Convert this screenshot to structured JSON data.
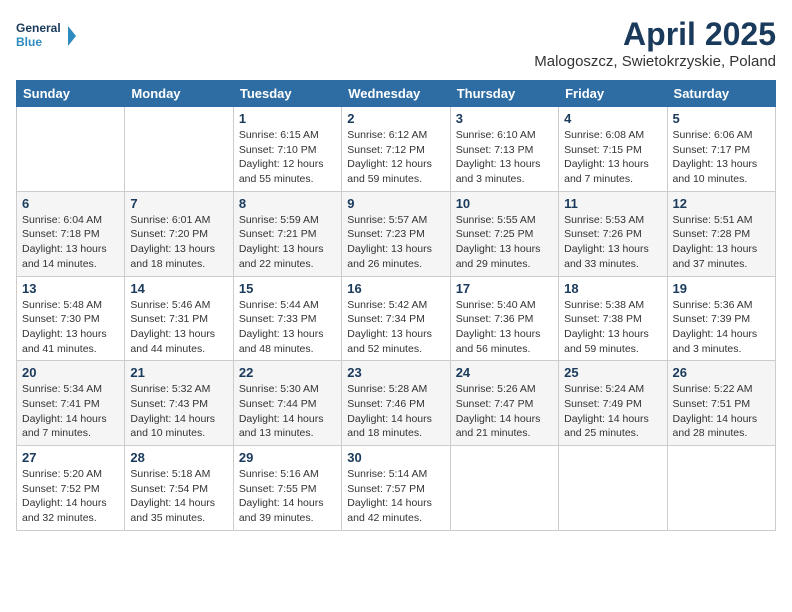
{
  "header": {
    "logo_line1": "General",
    "logo_line2": "Blue",
    "title": "April 2025",
    "subtitle": "Malogoszcz, Swietokrzyskie, Poland"
  },
  "weekdays": [
    "Sunday",
    "Monday",
    "Tuesday",
    "Wednesday",
    "Thursday",
    "Friday",
    "Saturday"
  ],
  "weeks": [
    [
      {
        "day": "",
        "info": ""
      },
      {
        "day": "",
        "info": ""
      },
      {
        "day": "1",
        "info": "Sunrise: 6:15 AM\nSunset: 7:10 PM\nDaylight: 12 hours\nand 55 minutes."
      },
      {
        "day": "2",
        "info": "Sunrise: 6:12 AM\nSunset: 7:12 PM\nDaylight: 12 hours\nand 59 minutes."
      },
      {
        "day": "3",
        "info": "Sunrise: 6:10 AM\nSunset: 7:13 PM\nDaylight: 13 hours\nand 3 minutes."
      },
      {
        "day": "4",
        "info": "Sunrise: 6:08 AM\nSunset: 7:15 PM\nDaylight: 13 hours\nand 7 minutes."
      },
      {
        "day": "5",
        "info": "Sunrise: 6:06 AM\nSunset: 7:17 PM\nDaylight: 13 hours\nand 10 minutes."
      }
    ],
    [
      {
        "day": "6",
        "info": "Sunrise: 6:04 AM\nSunset: 7:18 PM\nDaylight: 13 hours\nand 14 minutes."
      },
      {
        "day": "7",
        "info": "Sunrise: 6:01 AM\nSunset: 7:20 PM\nDaylight: 13 hours\nand 18 minutes."
      },
      {
        "day": "8",
        "info": "Sunrise: 5:59 AM\nSunset: 7:21 PM\nDaylight: 13 hours\nand 22 minutes."
      },
      {
        "day": "9",
        "info": "Sunrise: 5:57 AM\nSunset: 7:23 PM\nDaylight: 13 hours\nand 26 minutes."
      },
      {
        "day": "10",
        "info": "Sunrise: 5:55 AM\nSunset: 7:25 PM\nDaylight: 13 hours\nand 29 minutes."
      },
      {
        "day": "11",
        "info": "Sunrise: 5:53 AM\nSunset: 7:26 PM\nDaylight: 13 hours\nand 33 minutes."
      },
      {
        "day": "12",
        "info": "Sunrise: 5:51 AM\nSunset: 7:28 PM\nDaylight: 13 hours\nand 37 minutes."
      }
    ],
    [
      {
        "day": "13",
        "info": "Sunrise: 5:48 AM\nSunset: 7:30 PM\nDaylight: 13 hours\nand 41 minutes."
      },
      {
        "day": "14",
        "info": "Sunrise: 5:46 AM\nSunset: 7:31 PM\nDaylight: 13 hours\nand 44 minutes."
      },
      {
        "day": "15",
        "info": "Sunrise: 5:44 AM\nSunset: 7:33 PM\nDaylight: 13 hours\nand 48 minutes."
      },
      {
        "day": "16",
        "info": "Sunrise: 5:42 AM\nSunset: 7:34 PM\nDaylight: 13 hours\nand 52 minutes."
      },
      {
        "day": "17",
        "info": "Sunrise: 5:40 AM\nSunset: 7:36 PM\nDaylight: 13 hours\nand 56 minutes."
      },
      {
        "day": "18",
        "info": "Sunrise: 5:38 AM\nSunset: 7:38 PM\nDaylight: 13 hours\nand 59 minutes."
      },
      {
        "day": "19",
        "info": "Sunrise: 5:36 AM\nSunset: 7:39 PM\nDaylight: 14 hours\nand 3 minutes."
      }
    ],
    [
      {
        "day": "20",
        "info": "Sunrise: 5:34 AM\nSunset: 7:41 PM\nDaylight: 14 hours\nand 7 minutes."
      },
      {
        "day": "21",
        "info": "Sunrise: 5:32 AM\nSunset: 7:43 PM\nDaylight: 14 hours\nand 10 minutes."
      },
      {
        "day": "22",
        "info": "Sunrise: 5:30 AM\nSunset: 7:44 PM\nDaylight: 14 hours\nand 13 minutes."
      },
      {
        "day": "23",
        "info": "Sunrise: 5:28 AM\nSunset: 7:46 PM\nDaylight: 14 hours\nand 18 minutes."
      },
      {
        "day": "24",
        "info": "Sunrise: 5:26 AM\nSunset: 7:47 PM\nDaylight: 14 hours\nand 21 minutes."
      },
      {
        "day": "25",
        "info": "Sunrise: 5:24 AM\nSunset: 7:49 PM\nDaylight: 14 hours\nand 25 minutes."
      },
      {
        "day": "26",
        "info": "Sunrise: 5:22 AM\nSunset: 7:51 PM\nDaylight: 14 hours\nand 28 minutes."
      }
    ],
    [
      {
        "day": "27",
        "info": "Sunrise: 5:20 AM\nSunset: 7:52 PM\nDaylight: 14 hours\nand 32 minutes."
      },
      {
        "day": "28",
        "info": "Sunrise: 5:18 AM\nSunset: 7:54 PM\nDaylight: 14 hours\nand 35 minutes."
      },
      {
        "day": "29",
        "info": "Sunrise: 5:16 AM\nSunset: 7:55 PM\nDaylight: 14 hours\nand 39 minutes."
      },
      {
        "day": "30",
        "info": "Sunrise: 5:14 AM\nSunset: 7:57 PM\nDaylight: 14 hours\nand 42 minutes."
      },
      {
        "day": "",
        "info": ""
      },
      {
        "day": "",
        "info": ""
      },
      {
        "day": "",
        "info": ""
      }
    ]
  ]
}
